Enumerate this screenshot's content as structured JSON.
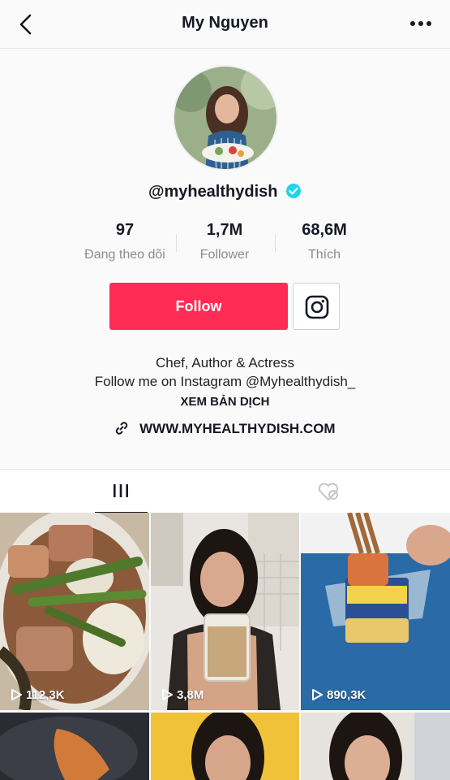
{
  "header": {
    "title": "My Nguyen"
  },
  "profile": {
    "handle": "@myhealthydish",
    "verified": true,
    "stats": [
      {
        "value": "97",
        "label": "Đang theo dõi"
      },
      {
        "value": "1,7M",
        "label": "Follower"
      },
      {
        "value": "68,6M",
        "label": "Thích"
      }
    ],
    "follow_label": "Follow",
    "bio_line1": "Chef, Author & Actress",
    "bio_line2": "Follow me on Instagram @Myhealthydish_",
    "translate_label": "XEM BẢN DỊCH",
    "website": "WWW.MYHEALTHYDISH.COM"
  },
  "tabs": [
    {
      "icon": "grid-icon",
      "active": true
    },
    {
      "icon": "liked-hidden-icon",
      "active": false
    }
  ],
  "videos": [
    {
      "views": "112,3K"
    },
    {
      "views": "3,8M"
    },
    {
      "views": "890,3K"
    },
    {
      "views": ""
    },
    {
      "views": ""
    },
    {
      "views": ""
    }
  ],
  "colors": {
    "accent": "#fe2c55",
    "verified": "#20d5ec",
    "text": "#161823",
    "muted": "#8a8b91"
  }
}
